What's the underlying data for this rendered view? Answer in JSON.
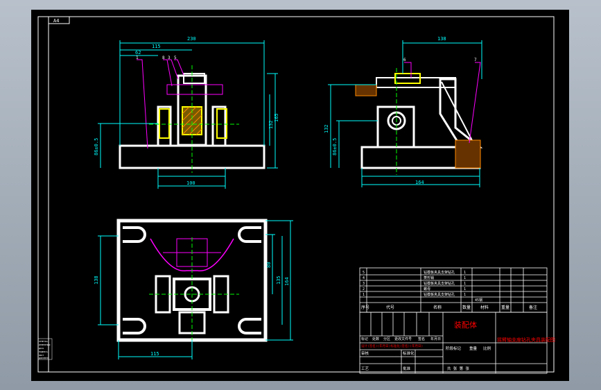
{
  "sheet": {
    "corner_tag": "A4",
    "colors": {
      "frame": "#ffffff",
      "part": "#ffffff",
      "dim": "#00ffff",
      "leader": "#ff00ff",
      "center": "#00ff00",
      "section": "#ffff00",
      "title": "#ff0000",
      "hatch": "#ff8800"
    }
  },
  "front_view": {
    "dims": {
      "overall_width": "230",
      "left_offset": "115",
      "small": "62",
      "overall_height": "165",
      "mid_height": "132",
      "left_height": "86±0.5",
      "base_width": "100"
    },
    "balloons": [
      "1",
      "8",
      "3",
      "5"
    ]
  },
  "side_view": {
    "dims": {
      "top_width": "138",
      "height": "132",
      "left_height": "86±0.5",
      "base_width": "164"
    },
    "balloons": [
      "6",
      "7"
    ]
  },
  "top_view": {
    "dims": {
      "depth": "138",
      "inner": "80",
      "right_a": "135",
      "right_b": "164",
      "bottom_offset": "115"
    }
  },
  "bom": {
    "rows": [
      {
        "no": "5",
        "name": "钻模板夹具支架钻孔",
        "qty": "1"
      },
      {
        "no": "4",
        "name": "菱形销",
        "qty": "1"
      },
      {
        "no": "3",
        "name": "钻模板夹具支架钻孔",
        "qty": "1"
      },
      {
        "no": "2",
        "name": "螺母",
        "qty": "1"
      },
      {
        "no": "1",
        "name": "钻模板夹具支架钻孔",
        "qty": "1"
      }
    ],
    "header": [
      "序号",
      "代号",
      "名称",
      "数量",
      "材料",
      "重量",
      "备注"
    ],
    "material_note": "45钢"
  },
  "title_block": {
    "drawing_type": "装配体",
    "drawing_title": "摇臂轴支座钻孔夹具装配图",
    "sign_labels": [
      "标记",
      "处数",
      "分区",
      "更改文件号",
      "签名",
      "年月日"
    ],
    "design_row": "设计(签名)(年月日)标准化(签名)(年月日)",
    "review": [
      "审核",
      "工艺"
    ],
    "approve": [
      "标准化",
      "批准"
    ],
    "stage_labels": [
      "阶段标记",
      "重量",
      "比例"
    ],
    "sheet_info": "共 张 第 张"
  },
  "legend": {
    "lines": [
      "ОТМЕТКА",
      "ИЗМЕНЕНИЯ",
      "ДАТА",
      "ПОДПИСЬ",
      "ЛИСТ",
      "ДОКУМЕНТ"
    ]
  }
}
